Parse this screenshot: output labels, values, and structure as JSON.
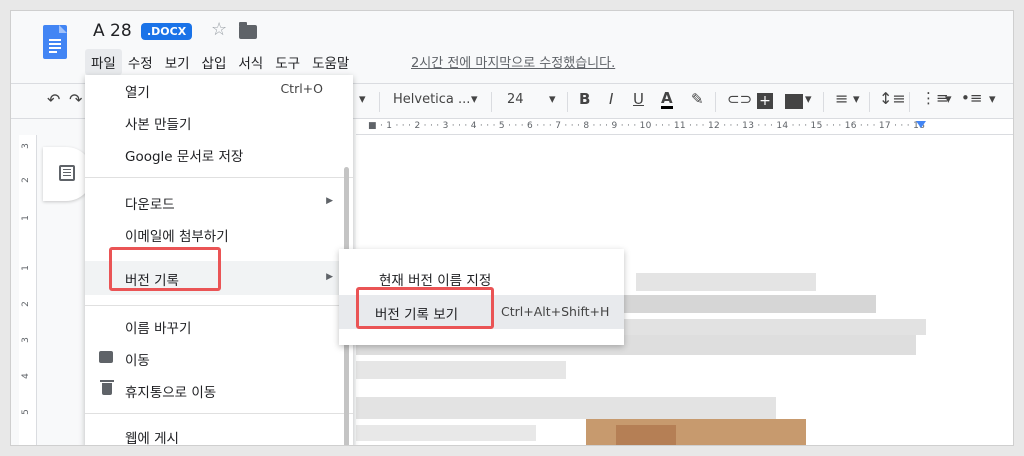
{
  "doc": {
    "title": "A 28",
    "badge": ".DOCX",
    "star_icon": "star-outline-icon",
    "folder_icon": "folder-icon"
  },
  "menubar": [
    "파일",
    "수정",
    "보기",
    "삽입",
    "서식",
    "도구",
    "도움말"
  ],
  "last_edit": "2시간 전에 마지막으로 수정했습니다.",
  "toolbar": {
    "font": "Helvetica ...",
    "size": "24",
    "bold": "B",
    "italic": "I",
    "underline": "U",
    "text_color": "A"
  },
  "ruler": "■ · 1 · · · 2 · · · 3 · · · 4 · · · 5 · · · 6 · · · 7 · · · 8 · · · 9 · · · 10 · · · 11 · · · 12 · · · 13 · · · 14 · · · 15 · · · 16 · · · 17 · · · 18",
  "vruler": [
    "3",
    "2",
    "1",
    "1",
    "2",
    "3",
    "4",
    "5"
  ],
  "file_menu": {
    "items": [
      {
        "label": "열기",
        "shortcut": "Ctrl+O"
      },
      {
        "label": "사본 만들기"
      },
      {
        "label": "Google 문서로 저장"
      },
      {
        "label": "다운로드",
        "arrow": "▶"
      },
      {
        "label": "이메일에 첨부하기"
      },
      {
        "label": "버전 기록",
        "arrow": "▶"
      },
      {
        "label": "이름 바꾸기"
      },
      {
        "label": "이동"
      },
      {
        "label": "휴지통으로 이동"
      },
      {
        "label": "웹에 게시"
      }
    ]
  },
  "version_submenu": {
    "items": [
      {
        "label": "현재 버전 이름 지정"
      },
      {
        "label": "버전 기록 보기",
        "shortcut": "Ctrl+Alt+Shift+H"
      }
    ]
  },
  "colors": {
    "accent": "#1a73e8",
    "highlight_box": "#ea5455",
    "doc_icon": "#4285f4"
  }
}
